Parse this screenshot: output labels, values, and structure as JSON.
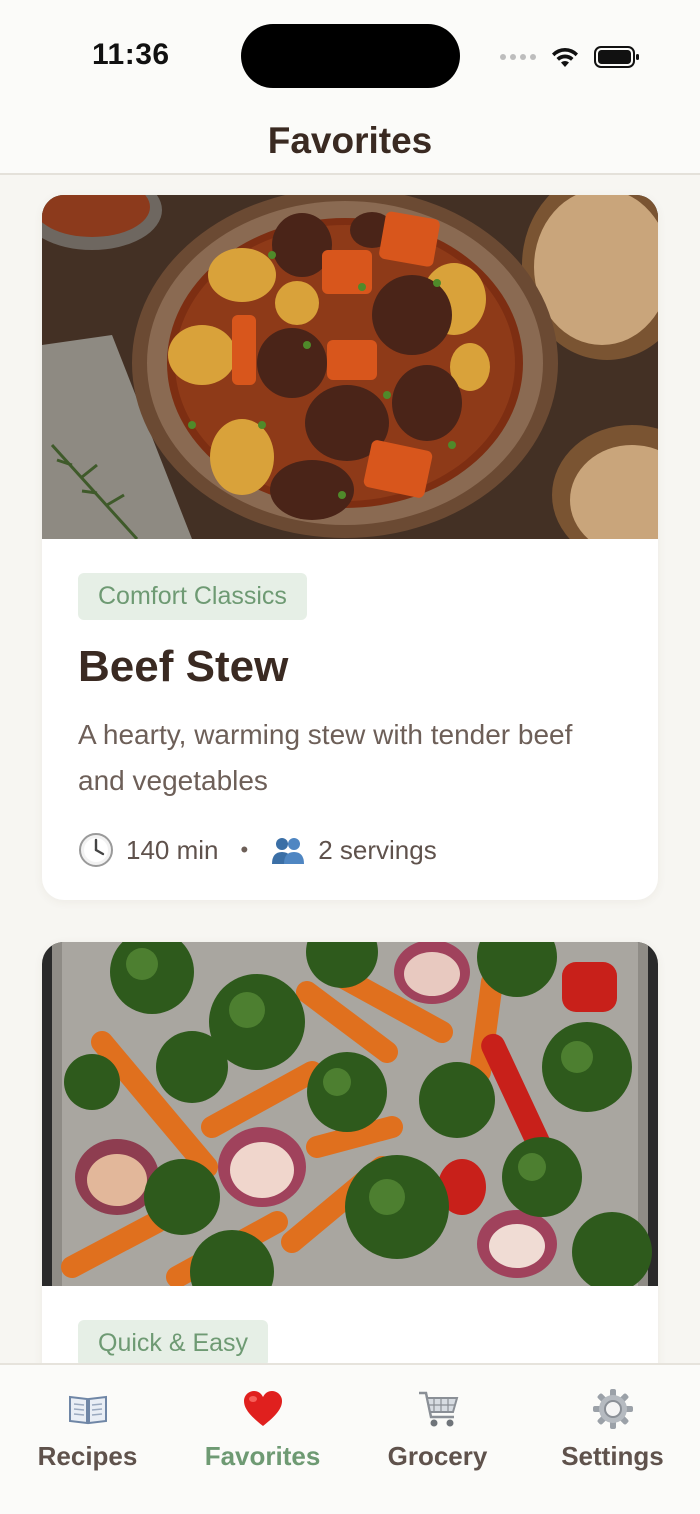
{
  "status_bar": {
    "time": "11:36"
  },
  "header": {
    "title": "Favorites"
  },
  "recipes": [
    {
      "category": "Comfort Classics",
      "title": "Beef Stew",
      "description": "A hearty, warming stew with tender beef and vegetables",
      "time": "140 min",
      "servings": "2 servings",
      "image": "beef-stew-photo"
    },
    {
      "category": "Quick & Easy",
      "image": "roasted-vegetables-photo"
    }
  ],
  "tabs": [
    {
      "label": "Recipes",
      "icon": "book-icon",
      "active": false
    },
    {
      "label": "Favorites",
      "icon": "heart-icon",
      "active": true
    },
    {
      "label": "Grocery",
      "icon": "cart-icon",
      "active": false
    },
    {
      "label": "Settings",
      "icon": "gear-icon",
      "active": false
    }
  ],
  "colors": {
    "accent": "#6e9a73",
    "badge_bg": "#e6efe6",
    "title_text": "#3a2a22",
    "background": "#f7f6f2"
  }
}
